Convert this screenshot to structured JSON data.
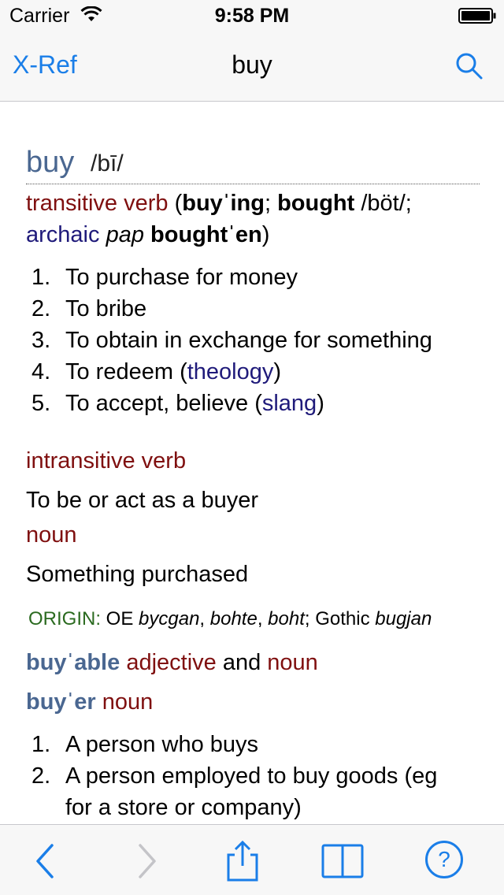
{
  "status_bar": {
    "carrier": "Carrier",
    "time": "9:58 PM"
  },
  "nav": {
    "back_label": "X-Ref",
    "title": "buy",
    "search_icon": "search-icon"
  },
  "entry": {
    "headword": "buy",
    "pronunciation": "/bī/",
    "tv_label": "transitive verb",
    "tv_open": " (",
    "form1": "buyˈing",
    "sep1": "; ",
    "form2": "bought",
    "form2_pron": " /böt/;",
    "archaic_label": "archaic",
    "pap_label": "pap",
    "form3": "boughtˈen",
    "form3_close": ")",
    "tv_defs": [
      {
        "num": "1.",
        "text": "To purchase for money"
      },
      {
        "num": "2.",
        "text": "To bribe"
      },
      {
        "num": "3.",
        "text": "To obtain in exchange for something"
      },
      {
        "num": "4.",
        "pre": "To redeem (",
        "tag": "theology",
        "post": ")"
      },
      {
        "num": "5.",
        "pre": "To accept, believe (",
        "tag": "slang",
        "post": ")"
      }
    ],
    "iv_label": "intransitive verb",
    "iv_def": "To be or act as a buyer",
    "noun_label": "noun",
    "noun_def": "Something purchased",
    "origin_label": "ORIGIN:",
    "origin_parts": {
      "oe": " OE ",
      "w1": "bycgan",
      "c1": ", ",
      "w2": "bohte",
      "c2": ", ",
      "w3": "boht",
      "c3": "; Gothic ",
      "w4": "bugjan"
    },
    "derived1_word": "buyˈable",
    "derived1_pos": "adjective",
    "derived1_and": "and",
    "derived1_pos2": "noun",
    "derived2_word": "buyˈer",
    "derived2_pos": "noun",
    "buyer_defs": [
      {
        "num": "1.",
        "text": "A person who buys"
      },
      {
        "num": "2.",
        "text": "A person employed to buy goods (eg"
      },
      {
        "num": "",
        "text": "for a store or company)"
      }
    ]
  },
  "toolbar": {
    "back_icon": "chevron-left-icon",
    "forward_icon": "chevron-right-icon",
    "share_icon": "share-icon",
    "book_icon": "book-icon",
    "help_icon": "help-icon",
    "help_glyph": "?"
  },
  "colors": {
    "accent": "#1a7ee8",
    "headword": "#4a6791",
    "pos": "#7f0f0f",
    "register": "#1f1a7a",
    "origin": "#2a6a1f"
  }
}
